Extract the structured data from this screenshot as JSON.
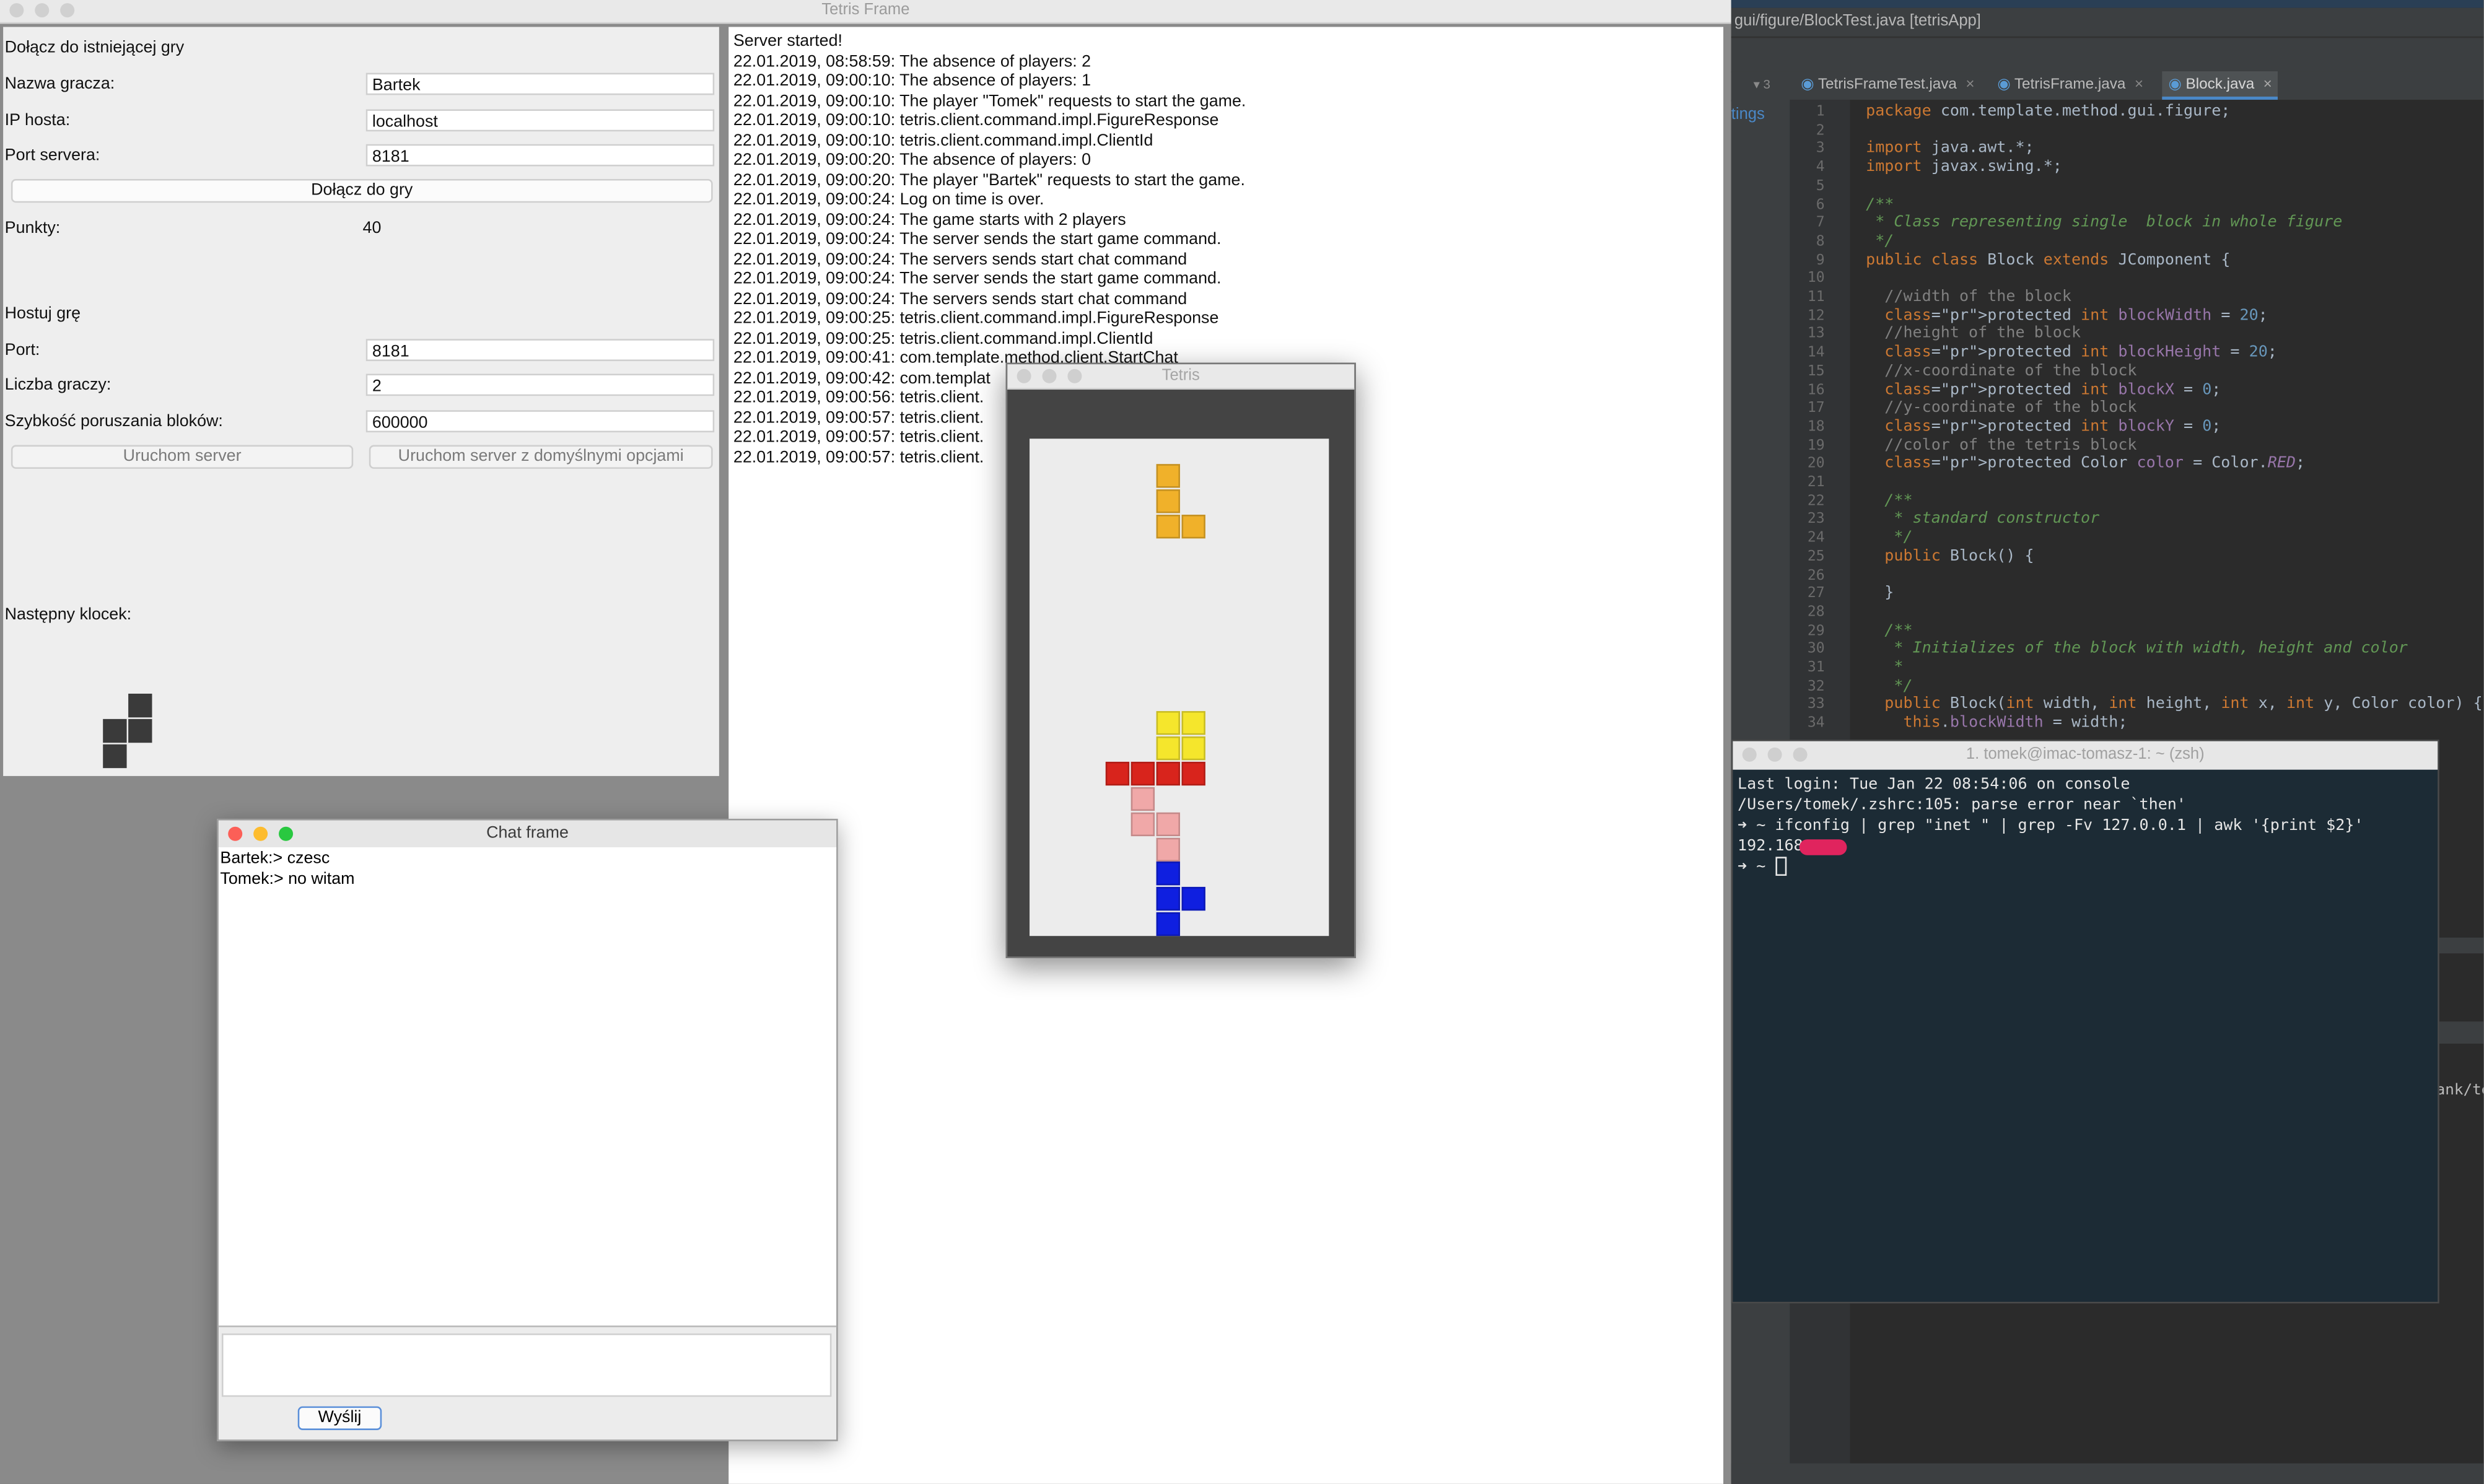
{
  "tetris_frame": {
    "title": "Tetris Frame",
    "join_section": {
      "heading": "Dołącz do istniejącej gry",
      "player_name_label": "Nazwa gracza:",
      "player_name_value": "Bartek",
      "host_ip_label": "IP hosta:",
      "host_ip_value": "localhost",
      "server_port_label": "Port servera:",
      "server_port_value": "8181",
      "join_button": "Dołącz do gry",
      "points_label": "Punkty:",
      "points_value": "40"
    },
    "host_section": {
      "heading": "Hostuj grę",
      "port_label": "Port:",
      "port_value": "8181",
      "players_label": "Liczba graczy:",
      "players_value": "2",
      "speed_label": "Szybkość poruszania bloków:",
      "speed_value": "600000",
      "start_server_button": "Uruchom server",
      "start_default_button": "Uruchom server z domyślnymi opcjami"
    },
    "next_block_label": "Następny klocek:",
    "next_block_color": "#3a3a3a",
    "log_lines": [
      "Server started!",
      "22.01.2019, 08:58:59: The absence of players: 2",
      "22.01.2019, 09:00:10: The absence of players: 1",
      "22.01.2019, 09:00:10: The player \"Tomek\" requests to start the game.",
      "22.01.2019, 09:00:10: tetris.client.command.impl.FigureResponse",
      "22.01.2019, 09:00:10: tetris.client.command.impl.ClientId",
      "22.01.2019, 09:00:20: The absence of players: 0",
      "22.01.2019, 09:00:20: The player \"Bartek\" requests to start the game.",
      "22.01.2019, 09:00:24: Log on time is over.",
      "22.01.2019, 09:00:24: The game starts with 2 players",
      "22.01.2019, 09:00:24: The server sends the start game command.",
      "22.01.2019, 09:00:24: The servers sends start chat command",
      "22.01.2019, 09:00:24: The server sends the start game command.",
      "22.01.2019, 09:00:24: The servers sends start chat command",
      "22.01.2019, 09:00:25: tetris.client.command.impl.FigureResponse",
      "22.01.2019, 09:00:25: tetris.client.command.impl.ClientId",
      "22.01.2019, 09:00:41: com.template.method.client.StartChat",
      "22.01.2019, 09:00:42: com.templat",
      "22.01.2019, 09:00:56: tetris.client.",
      "22.01.2019, 09:00:57: tetris.client.",
      "22.01.2019, 09:00:57: tetris.client.",
      "22.01.2019, 09:00:57: tetris.client."
    ]
  },
  "chat_frame": {
    "title": "Chat frame",
    "messages": [
      "Bartek:> czesc",
      "Tomek:> no witam"
    ],
    "input_value": "",
    "send_button": "Wyślij"
  },
  "tetris_window": {
    "title": "Tetris",
    "colors": {
      "orange": "#f0b12a",
      "yellow": "#f5e62c",
      "red": "#d8241c",
      "pink": "#f0a8a8",
      "blue": "#0f1fe0"
    }
  },
  "ide": {
    "title": "gui/figure/BlockTest.java [tetrisApp]",
    "side_label": "tings",
    "tabs": [
      "TetrisFrameTest.java",
      "TetrisFrame.java",
      "Block.java"
    ],
    "active_tab": "Block.java",
    "line_numbers": [
      "1",
      "2",
      "3",
      "4",
      "5",
      "6",
      "7",
      "8",
      "9",
      "10",
      "11",
      "12",
      "13",
      "14",
      "15",
      "16",
      "17",
      "18",
      "19",
      "20",
      "21",
      "22",
      "23",
      "24",
      "25",
      "26",
      "27",
      "28",
      "29",
      "30",
      "31",
      "32",
      "33",
      "34"
    ],
    "code_lines": [
      "package com.template.method.gui.figure;",
      "",
      "import java.awt.*;",
      "import javax.swing.*;",
      "",
      "/**",
      " * Class representing single  block in whole figure",
      " */",
      "public class Block extends JComponent {",
      "",
      "  //width of the block",
      "  protected int blockWidth = 20;",
      "  //height of the block",
      "  protected int blockHeight = 20;",
      "  //x-coordinate of the block",
      "  protected int blockX = 0;",
      "  //y-coordinate of the block",
      "  protected int blockY = 0;",
      "  //color of the tetris block",
      "  protected Color color = Color.RED;",
      "",
      "  /**",
      "   * standard constructor",
      "   */",
      "  public Block() {",
      "",
      "  }",
      "",
      "  /**",
      "   * Initializes of the block with width, height and color",
      "   *",
      "   */",
      "  public Block(int width, int height, int x, int y, Color color) {",
      "    this.blockWidth = width;"
    ],
    "partial_right_text": "ank/te"
  },
  "terminal": {
    "title": "1. tomek@imac-tomasz-1: ~ (zsh)",
    "lines": [
      "Last login: Tue Jan 22 08:54:06 on console",
      "/Users/tomek/.zshrc:105: parse error near `then'",
      "➜ ~ ifconfig | grep \"inet \" | grep -Fv 127.0.0.1 | awk '{print $2}'",
      "192.168",
      "➜ ~ "
    ]
  }
}
